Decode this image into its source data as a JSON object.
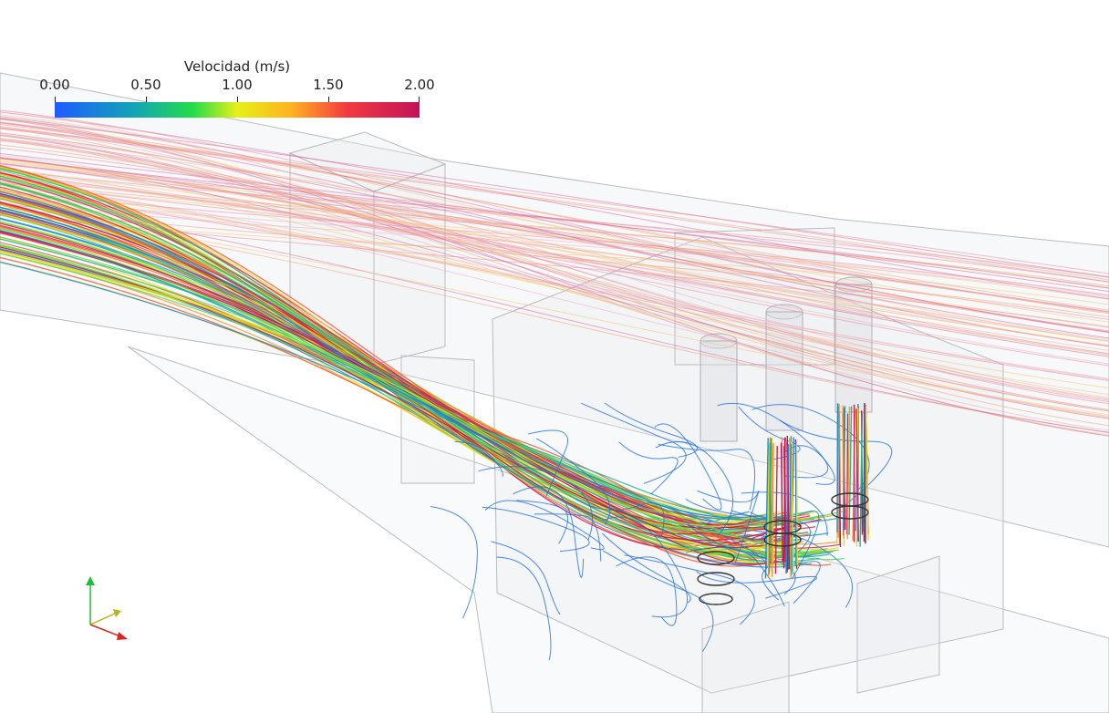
{
  "legend": {
    "title": "Velocidad (m/s)",
    "ticks": [
      "0.00",
      "0.50",
      "1.00",
      "1.50",
      "2.00"
    ]
  },
  "colormap": {
    "low": "#1f5bff",
    "mid": "#e6f019",
    "high": "#c4125a"
  },
  "orientation_axes": {
    "x_color": "#d9261c",
    "y_color": "#1fbf3a",
    "z_color": "#b8b418"
  }
}
